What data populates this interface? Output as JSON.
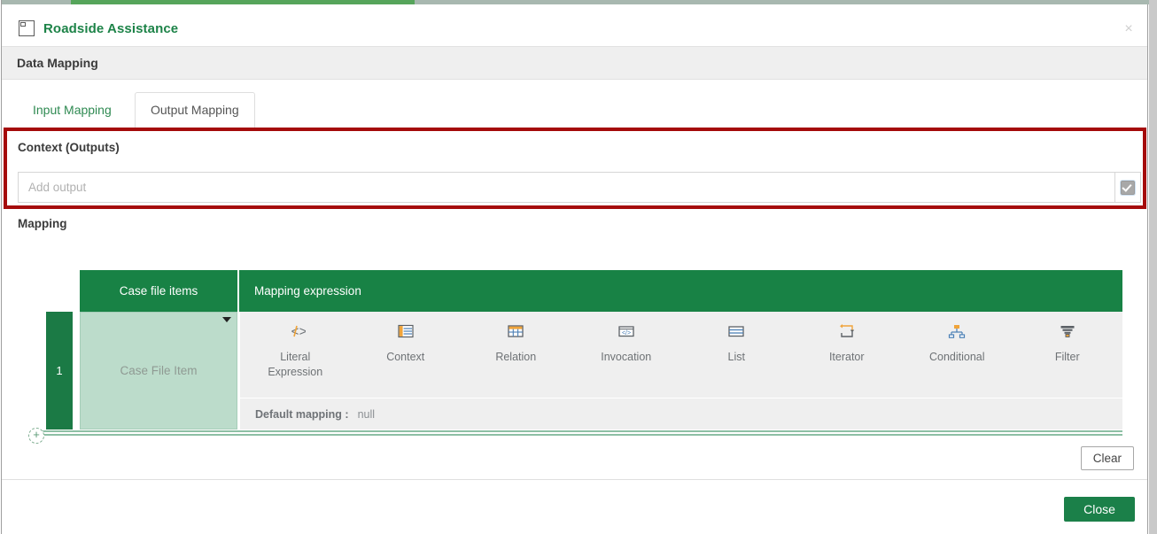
{
  "window": {
    "title": "Roadside Assistance",
    "title_icon": "case-file-icon",
    "close_icon": "×",
    "progress_percent": 30
  },
  "subheader": {
    "title": "Data Mapping"
  },
  "tabs": [
    {
      "label": "Input Mapping",
      "active": false
    },
    {
      "label": "Output Mapping",
      "active": true
    }
  ],
  "context_section": {
    "heading": "Context (Outputs)",
    "input_value": "",
    "input_placeholder": "Add output",
    "addon_icon": "checkbox-checked-icon",
    "highlight_color": "#a50b0b"
  },
  "mapping_section": {
    "heading": "Mapping",
    "columns": [
      "Case file items",
      "Mapping expression"
    ],
    "row": {
      "number": "1",
      "case_file_item": "Case File Item",
      "dropdown_icon": "caret-down-icon"
    },
    "expression_options": [
      {
        "label": "Literal\nExpression",
        "label_line1": "Literal",
        "label_line2": "Expression",
        "icon": "code-brackets-icon"
      },
      {
        "label": "Context",
        "label_line1": "Context",
        "label_line2": "",
        "icon": "context-list-icon"
      },
      {
        "label": "Relation",
        "label_line1": "Relation",
        "label_line2": "",
        "icon": "grid-table-icon"
      },
      {
        "label": "Invocation",
        "label_line1": "Invocation",
        "label_line2": "",
        "icon": "invocation-code-box-icon"
      },
      {
        "label": "List",
        "label_line1": "List",
        "label_line2": "",
        "icon": "list-rows-icon"
      },
      {
        "label": "Iterator",
        "label_line1": "Iterator",
        "label_line2": "",
        "icon": "iterator-loop-icon"
      },
      {
        "label": "Conditional",
        "label_line1": "Conditional",
        "label_line2": "",
        "icon": "conditional-branch-icon"
      },
      {
        "label": "Filter",
        "label_line1": "Filter",
        "label_line2": "",
        "icon": "filter-funnel-icon"
      }
    ],
    "default_mapping_label": "Default mapping :",
    "default_mapping_value": "null",
    "add_row_icon": "plus-circle-icon"
  },
  "actions": {
    "clear_label": "Clear",
    "close_label": "Close"
  },
  "colors": {
    "brand_green": "#188245",
    "header_green": "#1d8348",
    "progress_green": "#56a55b",
    "highlight_red": "#a50b0b",
    "cell_green": "#bcdccb",
    "icon_orange": "#f0a43a",
    "icon_blue": "#3c6fa8"
  }
}
